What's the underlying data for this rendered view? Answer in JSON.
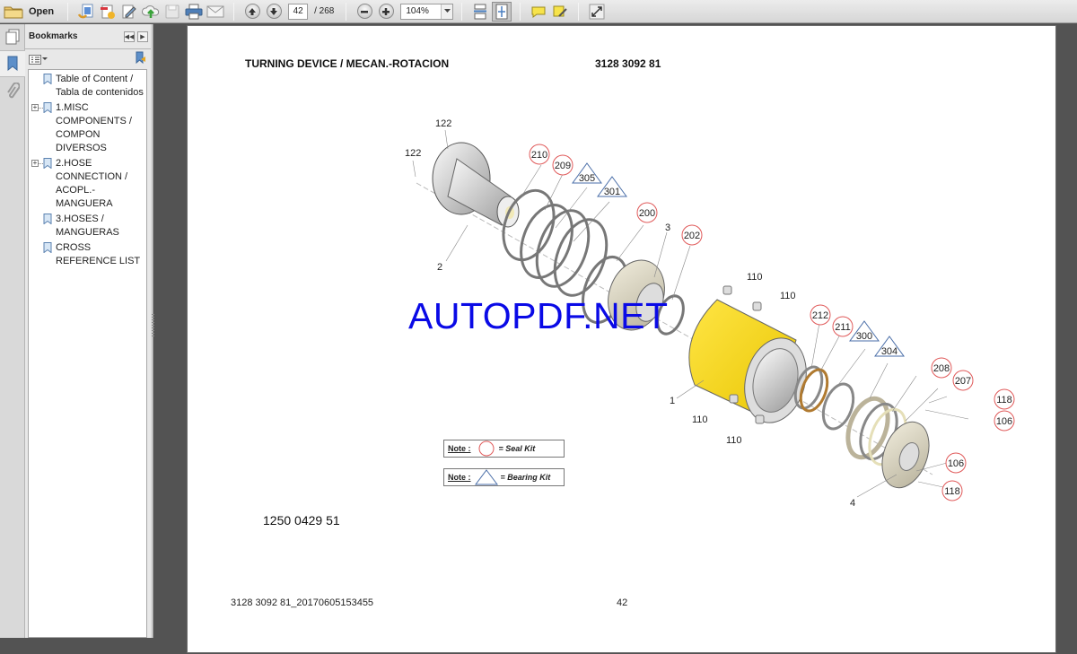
{
  "toolbar": {
    "open_label": "Open",
    "current_page": "42",
    "total_pages": "/ 268",
    "zoom_level": "104%",
    "icons": [
      "folder-open-icon",
      "create-pdf-icon",
      "combine-files-icon",
      "edit-icon",
      "upload-cloud-icon",
      "save-icon",
      "print-icon",
      "email-icon",
      "previous-page-icon",
      "next-page-icon",
      "zoom-out-icon",
      "zoom-in-icon",
      "fit-width-icon",
      "fit-page-icon",
      "comment-icon",
      "highlight-icon",
      "full-screen-icon"
    ]
  },
  "nav_pane": {
    "icons": [
      "pages-icon",
      "bookmarks-icon",
      "attachments-icon"
    ]
  },
  "bookmarks": {
    "title": "Bookmarks",
    "items": [
      {
        "label": "Table of Content / Tabla de contenidos",
        "expandable": false
      },
      {
        "label": "1.MISC COMPONENTS / COMPON DIVERSOS",
        "expandable": true
      },
      {
        "label": "2.HOSE CONNECTION / ACOPL.-MANGUERA",
        "expandable": true
      },
      {
        "label": "3.HOSES / MANGUERAS",
        "expandable": false
      },
      {
        "label": "CROSS REFERENCE LIST",
        "expandable": false
      }
    ]
  },
  "document": {
    "title": "TURNING DEVICE / MECAN.-ROTACION",
    "code": "3128 3092 81",
    "watermark": "AUTOPDF.NET",
    "part_number": "1250 0429 51",
    "footer_left": "3128 3092 81_20170605153455",
    "footer_page": "42",
    "notes": [
      {
        "label": "Note :",
        "text": "= Seal Kit",
        "symbol": "circle"
      },
      {
        "label": "Note :",
        "text": "= Bearing Kit",
        "symbol": "triangle"
      }
    ],
    "plain_labels": [
      "122",
      "122",
      "2",
      "3",
      "1",
      "4",
      "110",
      "110",
      "110",
      "110"
    ],
    "seal_kit_labels": [
      "210",
      "209",
      "200",
      "202",
      "212",
      "211",
      "208",
      "207",
      "118",
      "106",
      "106",
      "118"
    ],
    "bearing_kit_labels": [
      "305",
      "301",
      "300",
      "304"
    ],
    "colors": {
      "seal_circle": "#e05a5a",
      "bearing_triangle": "#4a6ea8",
      "housing": "#f7d417",
      "watermark": "#0a0ae6"
    }
  }
}
